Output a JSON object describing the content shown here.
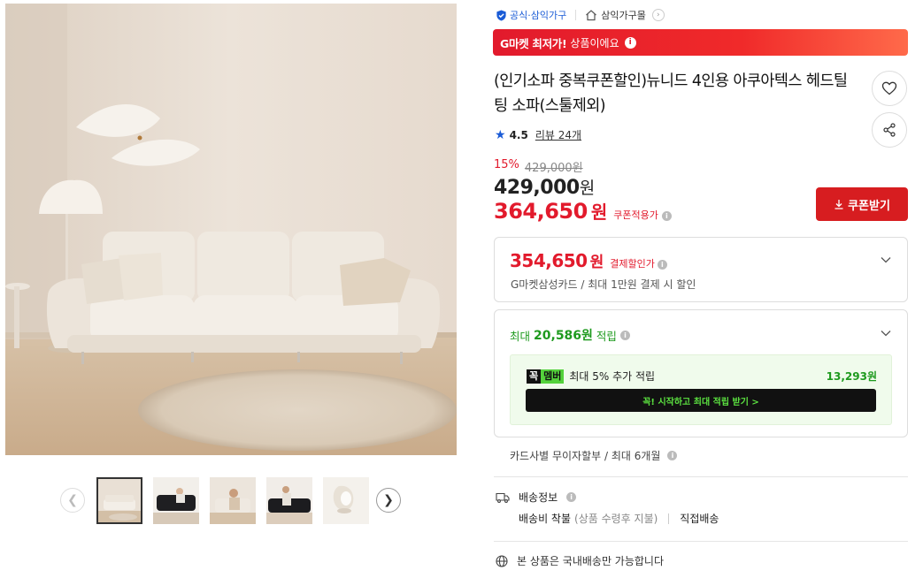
{
  "seller": {
    "official_label": "공식·삼익가구",
    "store_label": "삼익가구몰"
  },
  "promo": {
    "bold": "G마켓 최저가!",
    "text": "상품이에요"
  },
  "product": {
    "title": "(인기소파 중복쿠폰할인)뉴니드 4인용 아쿠아텍스 헤드틸팅 소파(스툴제외)",
    "rating": "4.5",
    "reviews_label": "리뷰 24개",
    "discount_rate": "15%",
    "original_price": "429,000원",
    "price": "429,000",
    "price_unit": "원",
    "coupon_price": "364,650",
    "coupon_price_unit": "원",
    "coupon_price_label": "쿠폰적용가",
    "coupon_button": "쿠폰받기"
  },
  "payment": {
    "price": "354,650",
    "unit": "원",
    "label": "결제할인가",
    "description": "G마켓삼성카드 / 최대 1만원 결제 시 할인"
  },
  "points": {
    "prefix": "최대",
    "amount": "20,586원",
    "suffix": "적립",
    "member_badge_a": "꼭",
    "member_badge_b": "멤버",
    "member_text": "최대 5% 추가 적립",
    "member_amount": "13,293원",
    "member_cta": "꼭! 시작하고 최대 적립 받기  >"
  },
  "installment": "카드사별 무이자할부 / 최대 6개월",
  "shipping": {
    "title": "배송정보",
    "fee": "배송비 착불",
    "fee_note": "(상품 수령후 지불)",
    "method": "직접배송"
  },
  "global_notice": "본 상품은 국내배송만 가능합니다",
  "colors": {
    "accent_red": "#e21a2c",
    "coupon_button": "#d71d20",
    "point_green": "#1e9a1e",
    "official_blue": "#1a5bd6"
  },
  "thumbnails": [
    {
      "name": "sofa-front",
      "active": true
    },
    {
      "name": "sofa-dark-person"
    },
    {
      "name": "sofa-person-sitting"
    },
    {
      "name": "sofa-person-dark"
    },
    {
      "name": "fabric-water-drop"
    }
  ]
}
